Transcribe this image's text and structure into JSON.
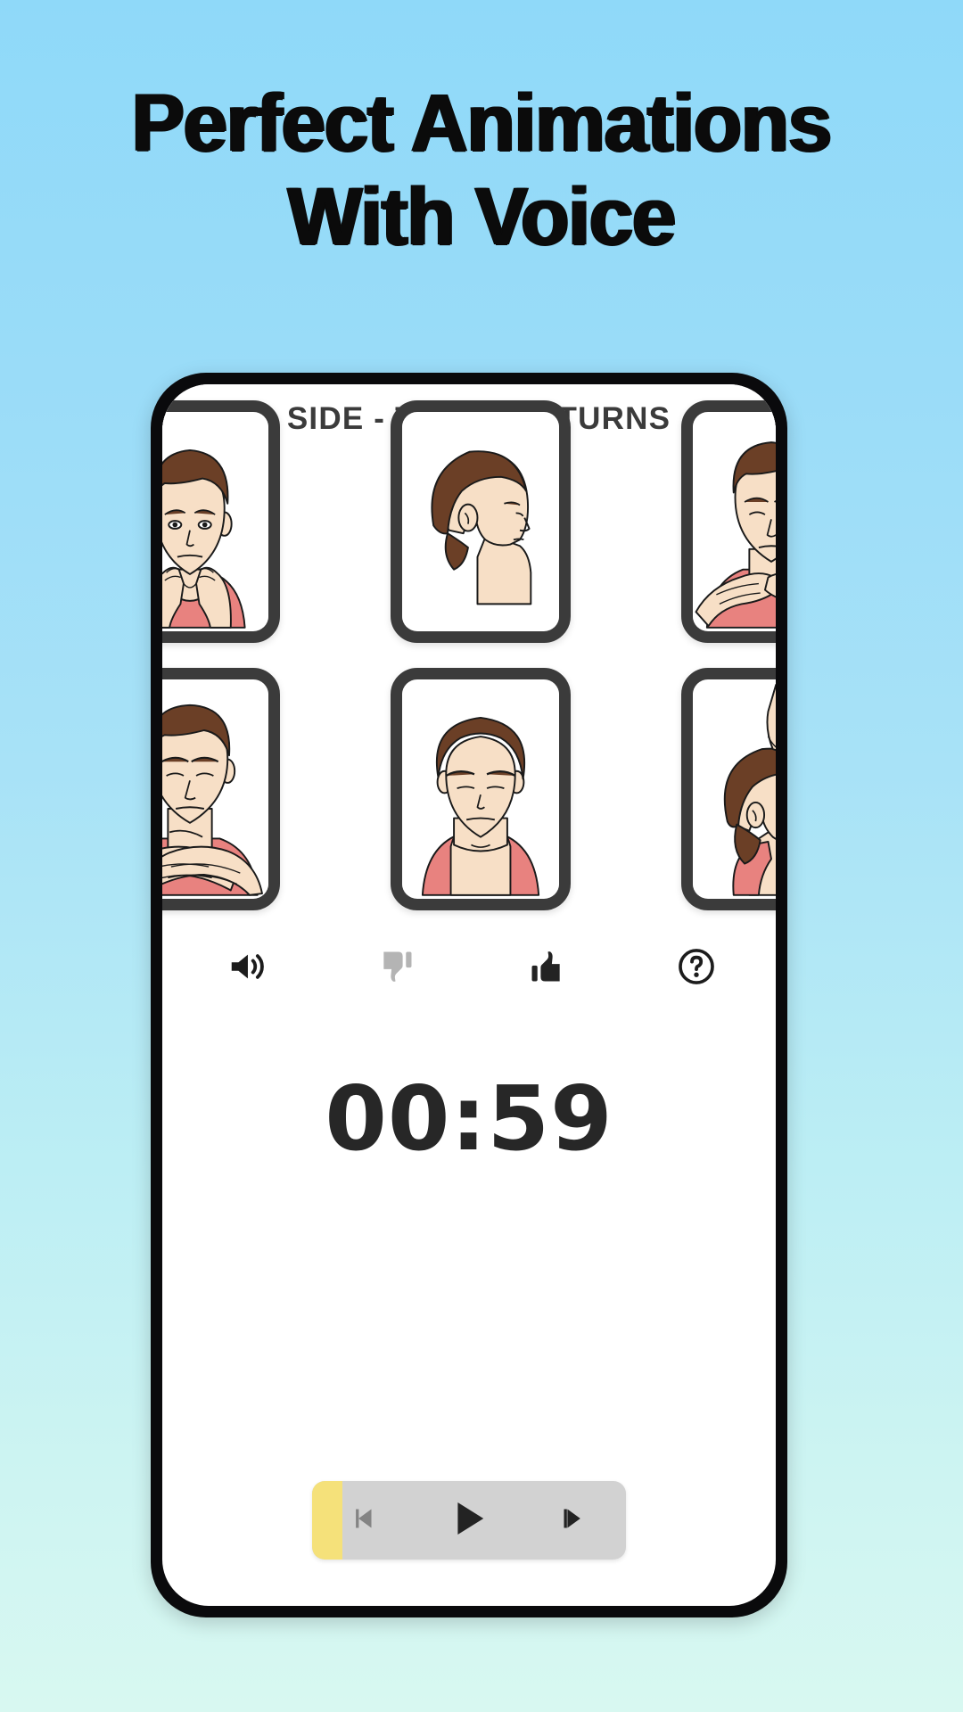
{
  "headline": {
    "line1": "Perfect Animations",
    "line2": "With Voice"
  },
  "colors": {
    "bg_top": "#8fd9f9",
    "bg_bottom": "#d8f8f1",
    "phone_frame": "#0a0a0c",
    "card_border": "#3b3b3b",
    "title": "#3b3b3b",
    "timer": "#272727",
    "progress_yellow": "#f5e17a",
    "player_track": "#d2d2d2",
    "skin": "#f7dfc6",
    "hair": "#6b3f26",
    "shirt": "#e8827f"
  },
  "app": {
    "header": {
      "back_icon": "arrow-left-icon",
      "title": "SIDE - TO - SIDE TURNS"
    },
    "cards": [
      {
        "id": "card-1",
        "alt": "man facing forward hands under chin",
        "pose": "front-hands-chin"
      },
      {
        "id": "card-2",
        "alt": "man head in profile facing right",
        "pose": "profile-right"
      },
      {
        "id": "card-3",
        "alt": "man head tilted back hands on neck",
        "pose": "head-back-hands-neck"
      },
      {
        "id": "card-4",
        "alt": "man looking up with crossed hands on chest",
        "pose": "look-up-crossed-hands"
      },
      {
        "id": "card-5",
        "alt": "man head bowed forward",
        "pose": "head-down"
      },
      {
        "id": "card-6",
        "alt": "man turning head with hand behind head",
        "pose": "turn-hand-behind"
      }
    ],
    "actions": [
      {
        "name": "sound-icon",
        "label": "Sound",
        "state": "on"
      },
      {
        "name": "thumbs-down-icon",
        "label": "Dislike",
        "state": "off"
      },
      {
        "name": "thumbs-up-icon",
        "label": "Like",
        "state": "on"
      },
      {
        "name": "help-circle-icon",
        "label": "Help",
        "state": "on"
      }
    ],
    "timer": "00:59",
    "player": {
      "previous_icon": "skip-previous-icon",
      "play_icon": "play-icon",
      "next_icon": "skip-next-icon",
      "progress_percent": 10
    }
  }
}
